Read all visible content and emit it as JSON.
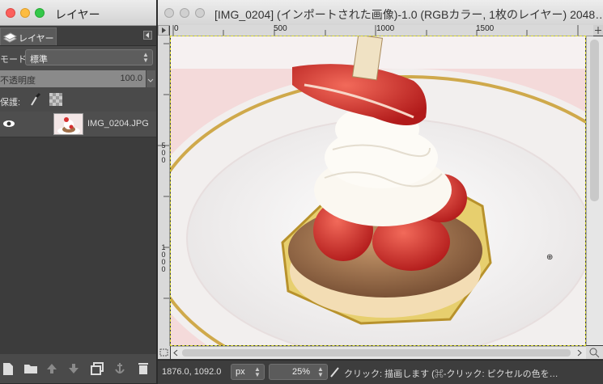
{
  "layers_window": {
    "title": "レイヤー",
    "tab_label": "レイヤー",
    "mode_label": "モード:",
    "mode_value": "標準",
    "opacity_label": "不透明度",
    "opacity_value": "100.0",
    "lock_label": "保護:",
    "layers": [
      {
        "name": "IMG_0204.JPG",
        "visible": true
      }
    ],
    "bottom_buttons": [
      "new-layer",
      "new-layer-group",
      "raise-layer",
      "lower-layer",
      "duplicate-layer",
      "anchor-layer",
      "delete-layer"
    ]
  },
  "image_window": {
    "title": "[IMG_0204] (インポートされた画像)-1.0 (RGBカラー, 1枚のレイヤー) 2048…",
    "ruler_h": [
      "0",
      "500",
      "1000",
      "1500"
    ],
    "ruler_v": [
      "5\n0\n0",
      "1\n0\n0\n0"
    ],
    "status": {
      "coords": "1876.0, 1092.0",
      "unit": "px",
      "zoom": "25%",
      "message": "クリック: 描画します (⌘-クリック: ピクセルの色を…"
    }
  },
  "colors": {
    "dock_bg": "#4a4a4a",
    "selection_outline": "#d6d62a",
    "close": "#fc605c",
    "minimize": "#fdbc40",
    "zoom": "#34c84a"
  }
}
